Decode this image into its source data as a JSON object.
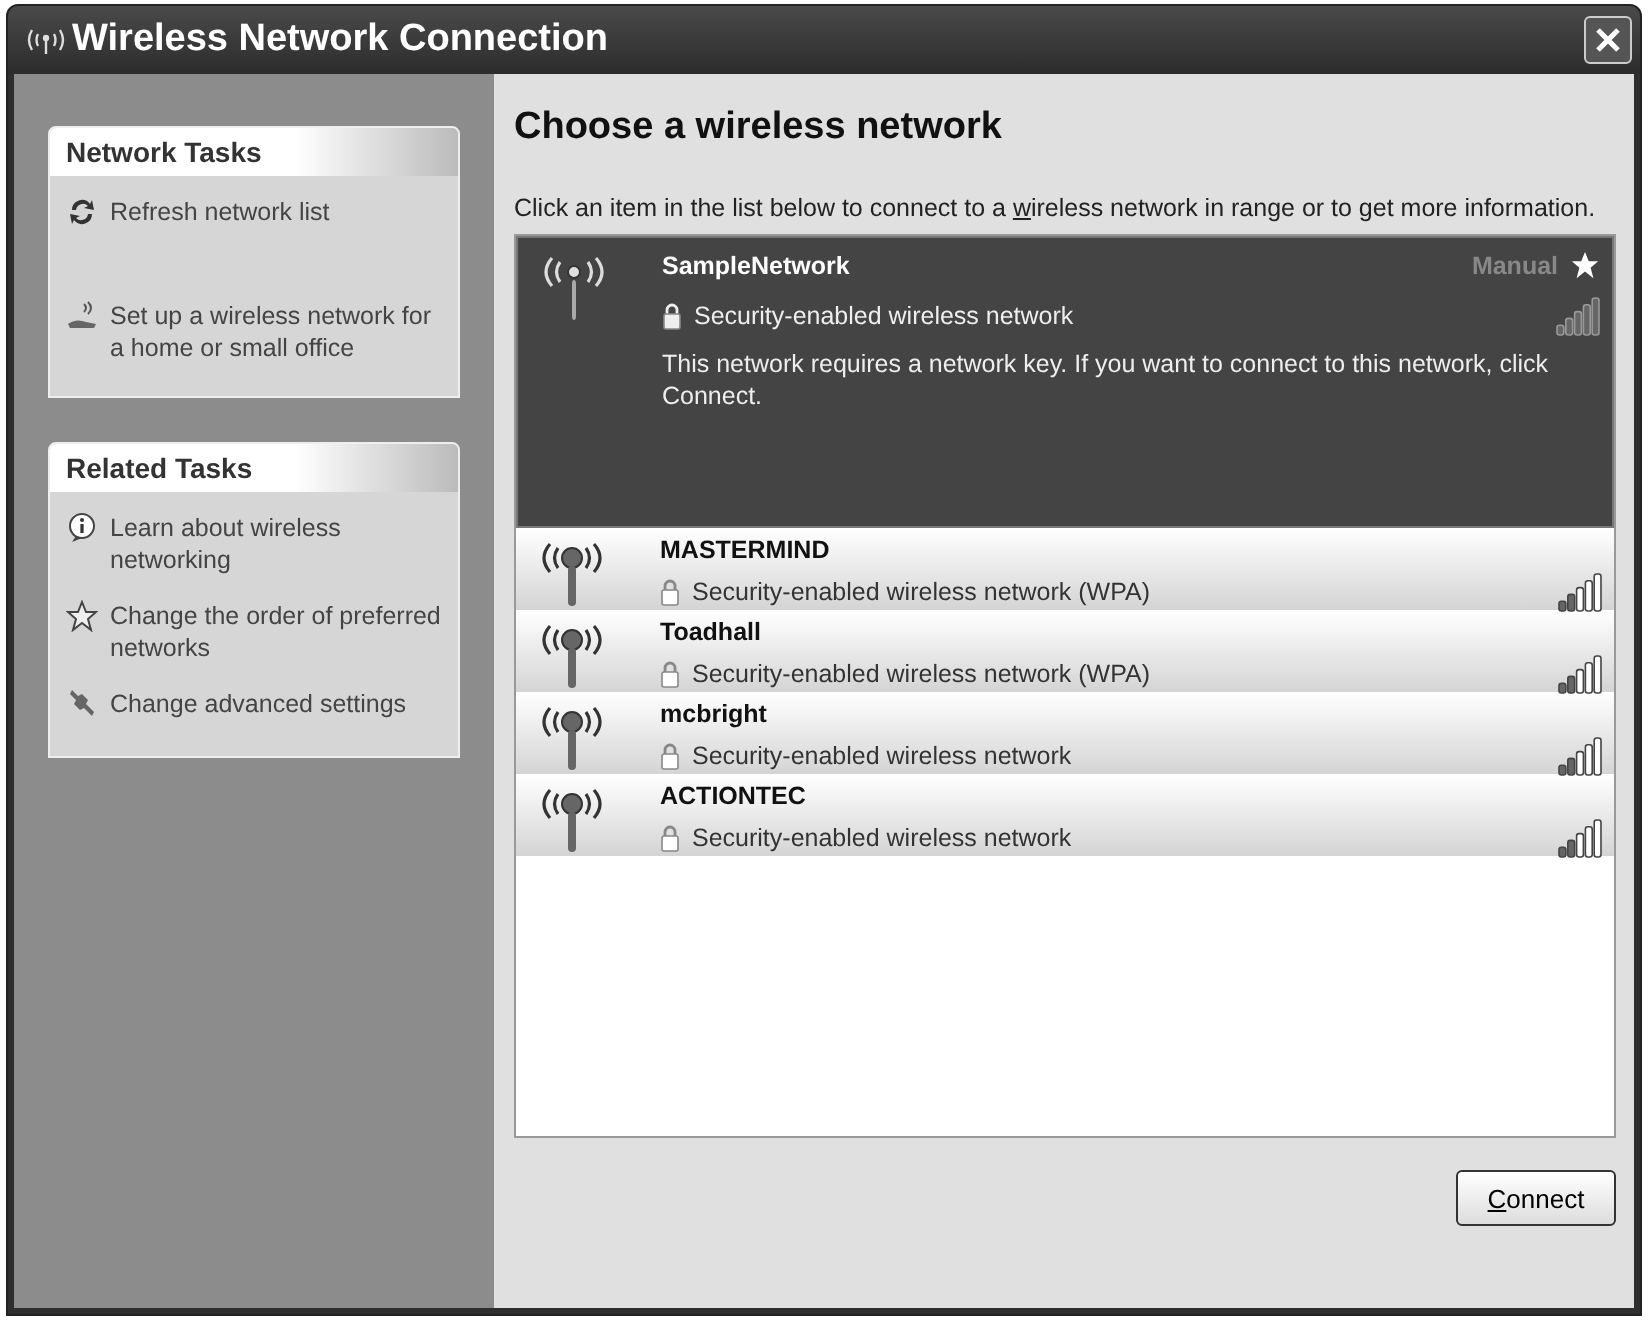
{
  "window": {
    "title": "Wireless Network Connection"
  },
  "sidebar": {
    "panels": [
      {
        "title": "Network Tasks",
        "items": [
          {
            "kind": "refresh",
            "label": "Refresh network list"
          },
          {
            "kind": "setup",
            "label": "Set up a wireless network for a home or small office"
          }
        ]
      },
      {
        "title": "Related Tasks",
        "items": [
          {
            "kind": "info",
            "label": "Learn about wireless networking"
          },
          {
            "kind": "star",
            "label": "Change the order of preferred networks"
          },
          {
            "kind": "settings",
            "label": "Change advanced settings"
          }
        ]
      }
    ]
  },
  "main": {
    "heading": "Choose a wireless network",
    "instruction": {
      "before": "Click an item in the list below to connect to a ",
      "key": "w",
      "after": "ireless network in range or to get more information."
    },
    "networks": [
      {
        "name": "SampleNetwork",
        "selected": true,
        "connection": "Manual",
        "preferred": true,
        "security": "Security-enabled wireless network",
        "details": "This network requires a network key. If you want to connect to this network, click Connect."
      },
      {
        "name": "MASTERMIND",
        "selected": false,
        "security": "Security-enabled wireless network (WPA)"
      },
      {
        "name": "Toadhall",
        "selected": false,
        "security": "Security-enabled wireless network (WPA)"
      },
      {
        "name": "mcbright",
        "selected": false,
        "security": "Security-enabled wireless network"
      },
      {
        "name": "ACTIONTEC",
        "selected": false,
        "security": "Security-enabled wireless network"
      }
    ],
    "connect_button": {
      "key": "C",
      "after": "onnect"
    }
  }
}
